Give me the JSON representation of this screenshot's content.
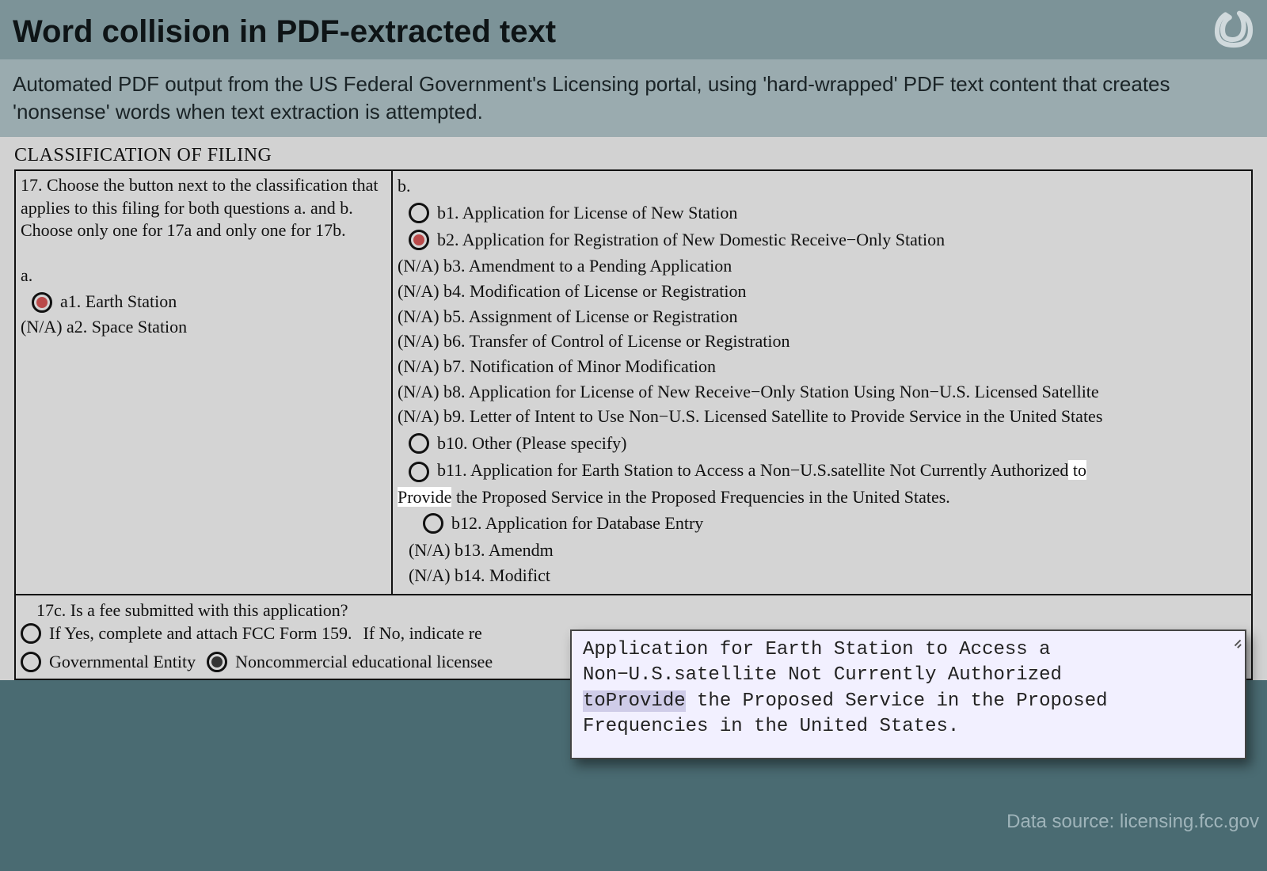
{
  "header": {
    "title": "Word collision in PDF-extracted text",
    "subtitle": "Automated PDF output from the US Federal Government's Licensing portal, using 'hard-wrapped' PDF text content that creates 'nonsense' words when text extraction is attempted."
  },
  "document": {
    "section_heading": "CLASSIFICATION OF FILING",
    "q17_intro": "17. Choose the button next to the classification that applies to this filing for both questions a. and b. Choose only one for 17a and only one for 17b.",
    "col_a": {
      "label": "a.",
      "a1_label": "a1. Earth Station",
      "a2_label": "(N/A) a2. Space Station"
    },
    "col_b": {
      "label": "b.",
      "b1_label": "b1. Application for License of New Station",
      "b2_label": "b2. Application for Registration of New Domestic Receive−Only Station",
      "b3_label": "(N/A) b3. Amendment to a Pending Application",
      "b4_label": "(N/A) b4. Modification of License or Registration",
      "b5_label": "(N/A) b5. Assignment of License or Registration",
      "b6_label": "(N/A) b6. Transfer of Control of License or Registration",
      "b7_label": "(N/A) b7. Notification of Minor Modification",
      "b8_label": "(N/A) b8. Application for License of New Receive−Only Station Using Non−U.S. Licensed Satellite",
      "b9_label": "(N/A) b9. Letter of Intent to Use Non−U.S. Licensed Satellite to Provide Service in the United States",
      "b10_label": "b10. Other (Please specify)",
      "b11_pre": "b11. Application for Earth Station to Access a Non−U.S.satellite Not Currently Authorized",
      "b11_hl_to": " to ",
      "b11_mid": "Provide",
      "b11_post": " the Proposed Service in the Proposed Frequencies in the United States.",
      "b12_label": "b12. Application for Database Entry",
      "b13_label": "(N/A) b13. Amendm",
      "b14_label": "(N/A) b14. Modifict"
    },
    "q17c": {
      "question": "17c. Is a fee submitted with this application?",
      "if_yes": "If Yes, complete and attach FCC Form 159.",
      "if_no": "If No, indicate re",
      "gov_label": "Governmental Entity",
      "noncom_label": "Noncommercial educational licensee"
    }
  },
  "popup": {
    "line1": "Application for Earth Station to Access a",
    "line2": "Non−U.S.satellite Not Currently Authorized",
    "line3_hl": "toProvide",
    "line3_rest": " the Proposed Service in the Proposed",
    "line4": "Frequencies in the United States."
  },
  "footer": {
    "credit": "Data source: licensing.fcc.gov"
  }
}
